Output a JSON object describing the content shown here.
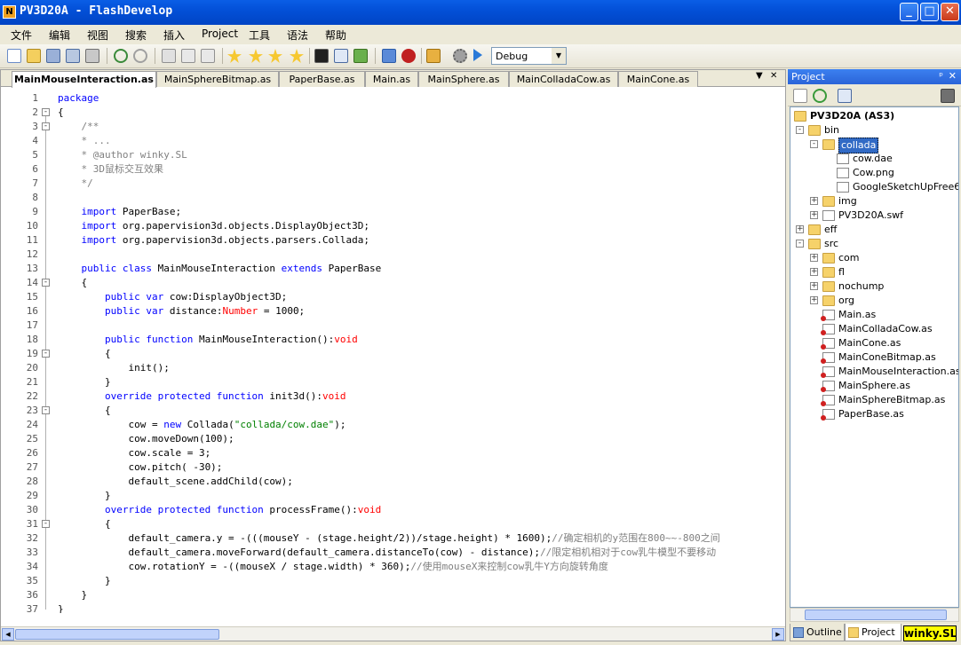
{
  "window": {
    "title": "PV3D20A - FlashDevelop",
    "minimize_label": "_",
    "maximize_label": "□",
    "close_label": "✕"
  },
  "menu": [
    "文件",
    "编辑",
    "视图",
    "搜索",
    "插入",
    "Project",
    "工具",
    "语法",
    "帮助"
  ],
  "toolbar": {
    "config_value": "Debug",
    "config_arrow": "▼"
  },
  "tabs": [
    {
      "label": "MainMouseInteraction.as",
      "active": true
    },
    {
      "label": "MainSphereBitmap.as"
    },
    {
      "label": "PaperBase.as"
    },
    {
      "label": "Main.as"
    },
    {
      "label": "MainSphere.as"
    },
    {
      "label": "MainColladaCow.as"
    },
    {
      "label": "MainCone.as"
    }
  ],
  "tab_controls": {
    "dropdown": "▼",
    "close": "✕"
  },
  "code_lines": [
    {
      "n": "1",
      "fold": "",
      "segs": [
        [
          "kw",
          "package"
        ]
      ]
    },
    {
      "n": "2",
      "fold": "-",
      "segs": [
        [
          "",
          "{"
        ]
      ]
    },
    {
      "n": "3",
      "fold": "-",
      "segs": [
        [
          "cm",
          "    /**"
        ]
      ]
    },
    {
      "n": "4",
      "fold": "",
      "segs": [
        [
          "cm",
          "    * ..."
        ]
      ]
    },
    {
      "n": "5",
      "fold": "",
      "segs": [
        [
          "cm",
          "    * @author winky.SL"
        ]
      ]
    },
    {
      "n": "6",
      "fold": "",
      "segs": [
        [
          "cm",
          "    * 3D鼠标交互效果"
        ]
      ]
    },
    {
      "n": "7",
      "fold": "",
      "segs": [
        [
          "cm",
          "    */"
        ]
      ]
    },
    {
      "n": "8",
      "fold": "",
      "segs": [
        [
          "",
          ""
        ]
      ]
    },
    {
      "n": "9",
      "fold": "",
      "segs": [
        [
          "kw",
          "    import "
        ],
        [
          "",
          "PaperBase;"
        ]
      ]
    },
    {
      "n": "10",
      "fold": "",
      "segs": [
        [
          "kw",
          "    import "
        ],
        [
          "",
          "org.papervision3d.objects.DisplayObject3D;"
        ]
      ]
    },
    {
      "n": "11",
      "fold": "",
      "segs": [
        [
          "kw",
          "    import "
        ],
        [
          "",
          "org.papervision3d.objects.parsers.Collada;"
        ]
      ]
    },
    {
      "n": "12",
      "fold": "",
      "segs": [
        [
          "",
          ""
        ]
      ]
    },
    {
      "n": "13",
      "fold": "",
      "segs": [
        [
          "kw",
          "    public class "
        ],
        [
          "",
          "MainMouseInteraction "
        ],
        [
          "kw",
          "extends "
        ],
        [
          "",
          "PaperBase"
        ]
      ]
    },
    {
      "n": "14",
      "fold": "-",
      "segs": [
        [
          "",
          "    {"
        ]
      ]
    },
    {
      "n": "15",
      "fold": "",
      "segs": [
        [
          "kw",
          "        public var "
        ],
        [
          "",
          "cow:DisplayObject3D;"
        ]
      ]
    },
    {
      "n": "16",
      "fold": "",
      "segs": [
        [
          "kw",
          "        public var "
        ],
        [
          "",
          "distance:"
        ],
        [
          "nm",
          "Number"
        ],
        [
          "",
          " = 1000;"
        ]
      ]
    },
    {
      "n": "17",
      "fold": "",
      "segs": [
        [
          "",
          ""
        ]
      ]
    },
    {
      "n": "18",
      "fold": "",
      "segs": [
        [
          "kw",
          "        public function "
        ],
        [
          "",
          "MainMouseInteraction():"
        ],
        [
          "nm",
          "void"
        ]
      ]
    },
    {
      "n": "19",
      "fold": "-",
      "segs": [
        [
          "",
          "        {"
        ]
      ]
    },
    {
      "n": "20",
      "fold": "",
      "segs": [
        [
          "",
          "            init();"
        ]
      ]
    },
    {
      "n": "21",
      "fold": "",
      "segs": [
        [
          "",
          "        }"
        ]
      ]
    },
    {
      "n": "22",
      "fold": "",
      "segs": [
        [
          "kw",
          "        override protected function "
        ],
        [
          "",
          "init3d():"
        ],
        [
          "nm",
          "void"
        ]
      ]
    },
    {
      "n": "23",
      "fold": "-",
      "segs": [
        [
          "",
          "        {"
        ]
      ]
    },
    {
      "n": "24",
      "fold": "",
      "segs": [
        [
          "",
          "            cow = "
        ],
        [
          "kw",
          "new "
        ],
        [
          "",
          "Collada("
        ],
        [
          "str",
          "\"collada/cow.dae\""
        ],
        [
          "",
          ");"
        ]
      ]
    },
    {
      "n": "25",
      "fold": "",
      "segs": [
        [
          "",
          "            cow.moveDown(100);"
        ]
      ]
    },
    {
      "n": "26",
      "fold": "",
      "segs": [
        [
          "",
          "            cow.scale = 3;"
        ]
      ]
    },
    {
      "n": "27",
      "fold": "",
      "segs": [
        [
          "",
          "            cow.pitch( -30);"
        ]
      ]
    },
    {
      "n": "28",
      "fold": "",
      "segs": [
        [
          "",
          "            default_scene.addChild(cow);"
        ]
      ]
    },
    {
      "n": "29",
      "fold": "",
      "segs": [
        [
          "",
          "        }"
        ]
      ]
    },
    {
      "n": "30",
      "fold": "",
      "segs": [
        [
          "kw",
          "        override protected function "
        ],
        [
          "",
          "processFrame():"
        ],
        [
          "nm",
          "void"
        ]
      ]
    },
    {
      "n": "31",
      "fold": "-",
      "segs": [
        [
          "",
          "        {"
        ]
      ]
    },
    {
      "n": "32",
      "fold": "",
      "segs": [
        [
          "",
          "            default_camera.y = -(((mouseY - (stage.height/2))/stage.height) * 1600);"
        ],
        [
          "cm",
          "//确定相机的y范围在800~~-800之间"
        ]
      ]
    },
    {
      "n": "33",
      "fold": "",
      "segs": [
        [
          "",
          "            default_camera.moveForward(default_camera.distanceTo(cow) - distance);"
        ],
        [
          "cm",
          "//限定相机相对于cow乳牛模型不要移动"
        ]
      ]
    },
    {
      "n": "34",
      "fold": "",
      "segs": [
        [
          "",
          "            cow.rotationY = -((mouseX / stage.width) * 360);"
        ],
        [
          "cm",
          "//使用mouseX来控制cow乳牛Y方向旋转角度"
        ]
      ]
    },
    {
      "n": "35",
      "fold": "",
      "segs": [
        [
          "",
          "        }"
        ]
      ]
    },
    {
      "n": "36",
      "fold": "",
      "segs": [
        [
          "",
          "    }"
        ]
      ]
    },
    {
      "n": "37",
      "fold": "",
      "segs": [
        [
          "",
          "}"
        ]
      ]
    }
  ],
  "panel": {
    "title": "Project",
    "pin": "ᵖ",
    "close": "✕"
  },
  "tree": [
    {
      "label": "PV3D20A (AS3)",
      "depth": 0,
      "exp": "",
      "type": "root",
      "bold": true
    },
    {
      "label": "bin",
      "depth": 1,
      "exp": "-",
      "type": "folder"
    },
    {
      "label": "collada",
      "depth": 2,
      "exp": "-",
      "type": "folder",
      "selected": true
    },
    {
      "label": "cow.dae",
      "depth": 3,
      "exp": "",
      "type": "file"
    },
    {
      "label": "Cow.png",
      "depth": 3,
      "exp": "",
      "type": "file"
    },
    {
      "label": "GoogleSketchUpFree6.e",
      "depth": 3,
      "exp": "",
      "type": "file"
    },
    {
      "label": "img",
      "depth": 2,
      "exp": "+",
      "type": "folder"
    },
    {
      "label": "PV3D20A.swf",
      "depth": 2,
      "exp": "+",
      "type": "swf"
    },
    {
      "label": "eff",
      "depth": 1,
      "exp": "+",
      "type": "folder"
    },
    {
      "label": "src",
      "depth": 1,
      "exp": "-",
      "type": "folder"
    },
    {
      "label": "com",
      "depth": 2,
      "exp": "+",
      "type": "folder"
    },
    {
      "label": "fl",
      "depth": 2,
      "exp": "+",
      "type": "folder"
    },
    {
      "label": "nochump",
      "depth": 2,
      "exp": "+",
      "type": "folder"
    },
    {
      "label": "org",
      "depth": 2,
      "exp": "+",
      "type": "folder"
    },
    {
      "label": "Main.as",
      "depth": 2,
      "exp": "",
      "type": "as"
    },
    {
      "label": "MainColladaCow.as",
      "depth": 2,
      "exp": "",
      "type": "as"
    },
    {
      "label": "MainCone.as",
      "depth": 2,
      "exp": "",
      "type": "as"
    },
    {
      "label": "MainConeBitmap.as",
      "depth": 2,
      "exp": "",
      "type": "as"
    },
    {
      "label": "MainMouseInteraction.as",
      "depth": 2,
      "exp": "",
      "type": "as"
    },
    {
      "label": "MainSphere.as",
      "depth": 2,
      "exp": "",
      "type": "as"
    },
    {
      "label": "MainSphereBitmap.as",
      "depth": 2,
      "exp": "",
      "type": "as"
    },
    {
      "label": "PaperBase.as",
      "depth": 2,
      "exp": "",
      "type": "as"
    }
  ],
  "panel_tabs": [
    {
      "label": "Outline"
    },
    {
      "label": "Project",
      "active": true
    }
  ],
  "watermark": "winky.SL",
  "colors": {
    "titlebar": "#0350d8",
    "keyword": "#0000ff",
    "string": "#008000",
    "comment": "#808080",
    "type": "#ff0000",
    "selection": "#316ac5"
  }
}
